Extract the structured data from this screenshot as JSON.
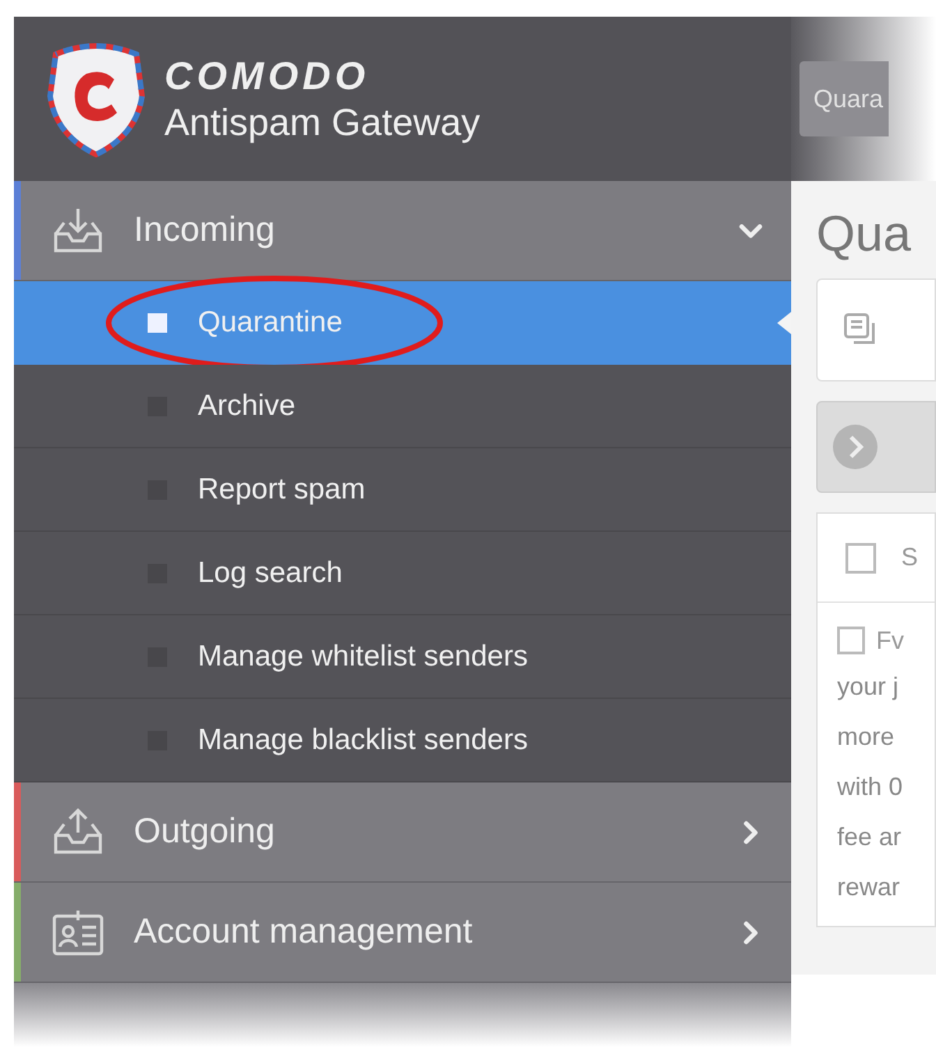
{
  "header": {
    "brand": "COMODO",
    "product": "Antispam Gateway",
    "top_button": "Quara"
  },
  "nav": [
    {
      "label": "Incoming",
      "kind": "incoming",
      "color": "#5b7fd6",
      "expanded": true,
      "children": [
        {
          "label": "Quarantine",
          "selected": true
        },
        {
          "label": "Archive",
          "selected": false
        },
        {
          "label": "Report spam",
          "selected": false
        },
        {
          "label": "Log search",
          "selected": false
        },
        {
          "label": "Manage whitelist senders",
          "selected": false
        },
        {
          "label": "Manage blacklist senders",
          "selected": false
        }
      ]
    },
    {
      "label": "Outgoing",
      "kind": "outgoing",
      "color": "#d95b5b",
      "expanded": false
    },
    {
      "label": "Account management",
      "kind": "account",
      "color": "#86ad6a",
      "expanded": false
    }
  ],
  "content": {
    "title": "Qua",
    "select_label": "S",
    "select_checked": false,
    "item": {
      "checked": false,
      "label": "Fv",
      "lines": [
        "your j",
        "more",
        "with 0",
        "fee ar",
        "rewar"
      ]
    }
  }
}
